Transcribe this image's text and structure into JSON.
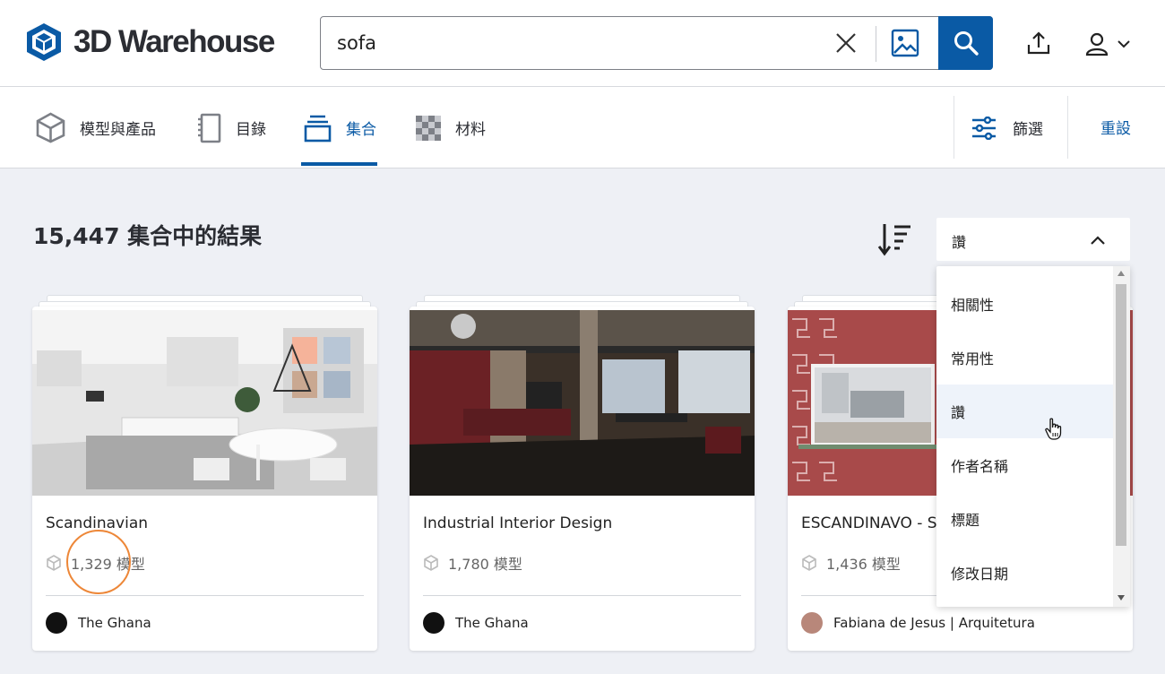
{
  "app": {
    "name": "3D Warehouse"
  },
  "search": {
    "value": "sofa",
    "placeholder": ""
  },
  "tabs": [
    {
      "label": "模型與產品",
      "icon": "cube-icon",
      "active": false
    },
    {
      "label": "目錄",
      "icon": "catalog-icon",
      "active": false
    },
    {
      "label": "集合",
      "icon": "collection-icon",
      "active": true
    },
    {
      "label": "材料",
      "icon": "material-icon",
      "active": false
    }
  ],
  "toolbar": {
    "filter_label": "篩選",
    "reset_label": "重設"
  },
  "results": {
    "title": "15,447 集合中的結果"
  },
  "sort": {
    "selected": "讚",
    "options": [
      "相關性",
      "常用性",
      "讚",
      "作者名稱",
      "標題",
      "修改日期"
    ],
    "hovered_index": 2
  },
  "cards": [
    {
      "title": "Scandinavian",
      "count": "1,329 模型",
      "author": "The Ghana"
    },
    {
      "title": "Industrial Interior Design",
      "count": "1,780 模型",
      "author": "The Ghana"
    },
    {
      "title": "ESCANDINAVO - S",
      "count": "1,436 模型",
      "author": "Fabiana de Jesus | Arquitetura"
    }
  ],
  "colors": {
    "brand_blue": "#0a5aa5",
    "highlight": "#ed8738",
    "page_bg": "#eef0f5"
  }
}
